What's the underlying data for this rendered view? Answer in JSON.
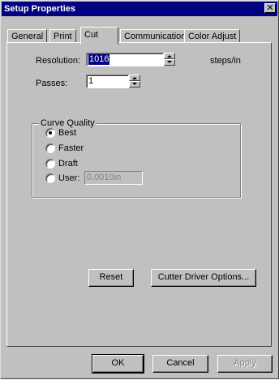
{
  "window": {
    "title": "Setup Properties",
    "close_glyph": "✕"
  },
  "tabs": [
    {
      "label": "General",
      "active": false
    },
    {
      "label": "Print",
      "active": false
    },
    {
      "label": "Cut",
      "active": true
    },
    {
      "label": "Communication",
      "active": false
    },
    {
      "label": "Color Adjust",
      "active": false
    }
  ],
  "cut": {
    "resolution_label": "Resolution:",
    "resolution_value": "1016",
    "resolution_unit": "steps/in",
    "passes_label": "Passes:",
    "passes_value": "1",
    "curve_quality": {
      "title": "Curve Quality",
      "options": [
        {
          "label": "Best",
          "checked": true
        },
        {
          "label": "Faster",
          "checked": false
        },
        {
          "label": "Draft",
          "checked": false
        },
        {
          "label": "User:",
          "checked": false
        }
      ],
      "user_value": "0.0010in"
    },
    "reset_label": "Reset",
    "driver_options_label": "Cutter Driver Options..."
  },
  "footer": {
    "ok_label": "OK",
    "cancel_label": "Cancel",
    "apply_label": "Apply"
  },
  "icons": {
    "close": "close-icon",
    "spin_up": "arrow-up-icon",
    "spin_down": "arrow-down-icon"
  },
  "colors": {
    "face": "#c0c0c0",
    "titlebar": "#000080",
    "highlight": "#000080"
  }
}
